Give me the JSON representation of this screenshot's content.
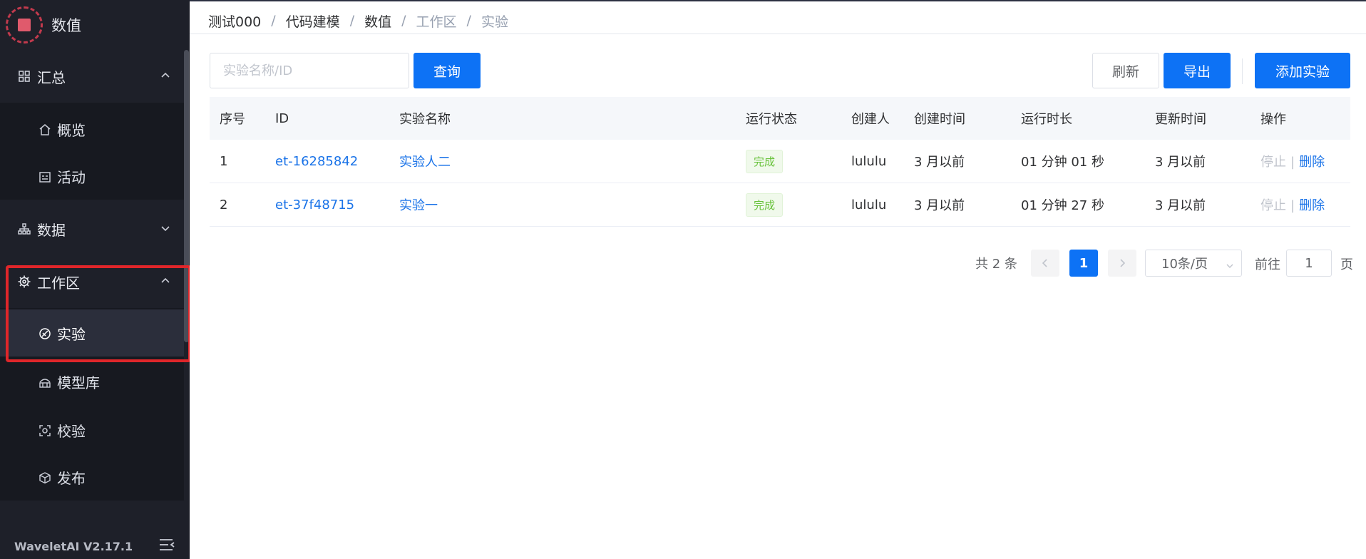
{
  "brand": {
    "title": "数值"
  },
  "sidebar": {
    "groups": [
      {
        "label": "汇总",
        "items": [
          "概览",
          "活动"
        ]
      },
      {
        "label": "数据"
      },
      {
        "label": "工作区",
        "items": [
          "实验",
          "模型库",
          "校验",
          "发布"
        ]
      }
    ],
    "active_item": "实验",
    "version": "WaveletAI V2.17.1"
  },
  "breadcrumb": [
    "测试000",
    "代码建模",
    "数值",
    "工作区",
    "实验"
  ],
  "toolbar": {
    "search_placeholder": "实验名称/ID",
    "search_button": "查询",
    "refresh_button": "刷新",
    "export_button": "导出",
    "add_button": "添加实验"
  },
  "table": {
    "headers": [
      "序号",
      "ID",
      "实验名称",
      "运行状态",
      "创建人",
      "创建时间",
      "运行时长",
      "更新时间",
      "操作"
    ],
    "rows": [
      {
        "index": "1",
        "id": "et-16285842",
        "name": "实验人二",
        "status": "完成",
        "creator": "lululu",
        "created": "3 月以前",
        "duration": "01 分钟 01 秒",
        "updated": "3 月以前",
        "op_stop": "停止",
        "op_sep": "|",
        "op_delete": "删除"
      },
      {
        "index": "2",
        "id": "et-37f48715",
        "name": "实验一",
        "status": "完成",
        "creator": "lululu",
        "created": "3 月以前",
        "duration": "01 分钟 27 秒",
        "updated": "3 月以前",
        "op_stop": "停止",
        "op_sep": "|",
        "op_delete": "删除"
      }
    ]
  },
  "pagination": {
    "total_text": "共 2 条",
    "prev": "<",
    "current_page": "1",
    "next": ">",
    "page_size": "10条/页",
    "goto_label": "前往",
    "goto_value": "1",
    "goto_suffix": "页"
  },
  "colors": {
    "sidebar_bg": "#1e2029",
    "primary": "#0d72f5",
    "link": "#1a73e8",
    "success": "#67c23a",
    "highlight": "#e0262a"
  }
}
